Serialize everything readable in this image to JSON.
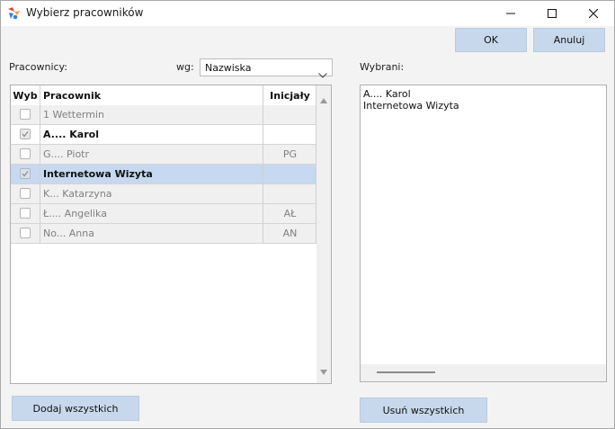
{
  "window": {
    "title": "Wybierz pracowników",
    "controls": [
      "minimize-icon",
      "maximize-icon",
      "close-icon"
    ]
  },
  "buttons": {
    "ok": "OK",
    "cancel": "Anuluj",
    "add_all": "Dodaj wszystkich",
    "remove_all": "Usuń wszystkich"
  },
  "left": {
    "label": "Pracownicy:",
    "sort_label": "wg:",
    "sort_value": "Nazwiska"
  },
  "grid": {
    "columns": [
      "Wyb",
      "Pracownik",
      "Inicjały"
    ],
    "rows": [
      {
        "name": "1 Wettermin",
        "initials": "",
        "checked": false,
        "bold": false,
        "selected": false,
        "bg": "#f0f0f0"
      },
      {
        "name": "A.... Karol",
        "initials": "",
        "checked": true,
        "bold": true,
        "selected": false,
        "bg": "#ffffff"
      },
      {
        "name": "G.... Piotr",
        "initials": "PG",
        "checked": false,
        "bold": false,
        "selected": false,
        "bg": "#f0f0f0"
      },
      {
        "name": "Internetowa Wizyta",
        "initials": "",
        "checked": true,
        "bold": true,
        "selected": true,
        "bg": "#c6d9f0"
      },
      {
        "name": "K... Katarzyna",
        "initials": "",
        "checked": false,
        "bold": false,
        "selected": false,
        "bg": "#f0f0f0"
      },
      {
        "name": "Ł.... Angelika",
        "initials": "AŁ",
        "checked": false,
        "bold": false,
        "selected": false,
        "bg": "#f0f0f0"
      },
      {
        "name": "No... Anna",
        "initials": "AN",
        "checked": false,
        "bold": false,
        "selected": false,
        "bg": "#f0f0f0"
      }
    ]
  },
  "right": {
    "label": "Wybrani:",
    "items": [
      "A.... Karol",
      "Internetowa Wizyta"
    ]
  },
  "colors": {
    "button_bg": "#c8d8ec",
    "selected_row": "#c6d9f0",
    "muted_text": "#808080"
  }
}
